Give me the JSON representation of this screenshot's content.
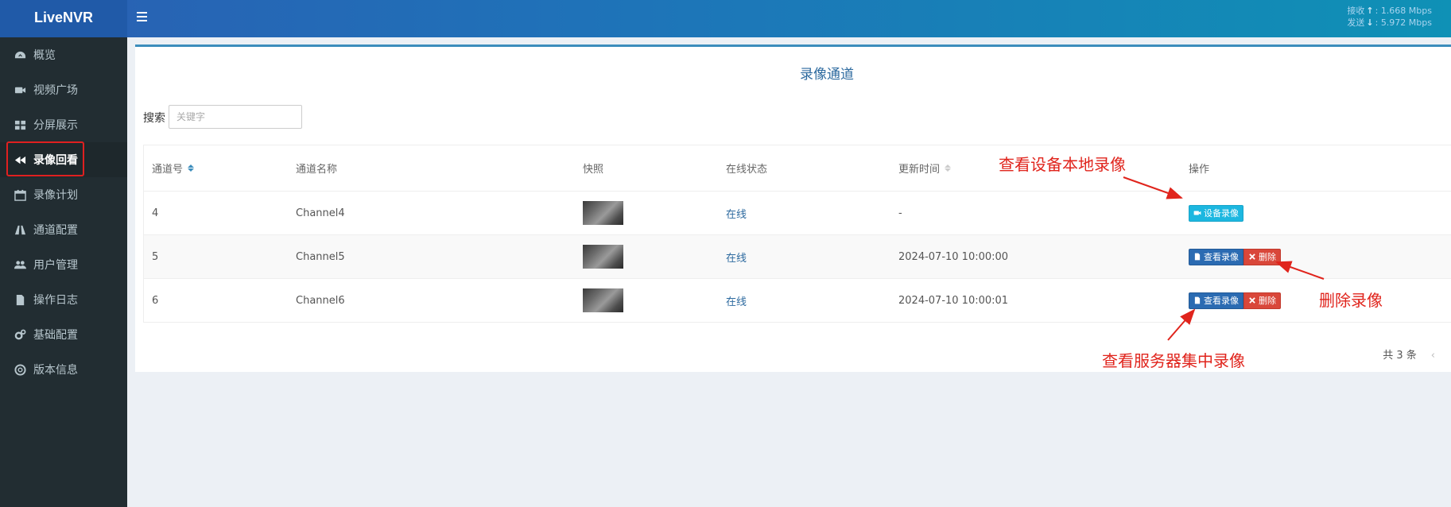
{
  "app": {
    "logo": "LiveNVR",
    "speed": {
      "recv_label": "接收",
      "recv_value": "1.668 Mbps",
      "send_label": "发送",
      "send_value": "5.972 Mbps"
    }
  },
  "sidebar": {
    "items": [
      {
        "label": "概览",
        "icon": "dashboard-icon"
      },
      {
        "label": "视频广场",
        "icon": "video-camera-icon"
      },
      {
        "label": "分屏展示",
        "icon": "grid-icon"
      },
      {
        "label": "录像回看",
        "icon": "rewind-icon",
        "active": true
      },
      {
        "label": "录像计划",
        "icon": "calendar-icon"
      },
      {
        "label": "通道配置",
        "icon": "road-icon"
      },
      {
        "label": "用户管理",
        "icon": "users-icon"
      },
      {
        "label": "操作日志",
        "icon": "file-icon"
      },
      {
        "label": "基础配置",
        "icon": "cogs-icon"
      },
      {
        "label": "版本信息",
        "icon": "life-ring-icon"
      }
    ]
  },
  "main": {
    "title": "录像通道",
    "search": {
      "label": "搜索",
      "placeholder": "关键字"
    },
    "table": {
      "columns": [
        "通道号",
        "通道名称",
        "快照",
        "在线状态",
        "更新时间",
        "操作"
      ],
      "rows": [
        {
          "id": "4",
          "name": "Channel4",
          "status": "在线",
          "updated": "-",
          "actions": [
            "设备录像"
          ]
        },
        {
          "id": "5",
          "name": "Channel5",
          "status": "在线",
          "updated": "2024-07-10 10:00:00",
          "actions": [
            "查看录像",
            "删除"
          ]
        },
        {
          "id": "6",
          "name": "Channel6",
          "status": "在线",
          "updated": "2024-07-10 10:00:01",
          "actions": [
            "查看录像",
            "删除"
          ]
        }
      ]
    },
    "pager": {
      "total": "共 3 条",
      "prev": "‹"
    }
  },
  "annotations": {
    "device_local": "查看设备本地录像",
    "delete": "删除录像",
    "server": "查看服务器集中录像"
  },
  "colors": {
    "accent": "#3c8dbc",
    "annotation": "#e0241c",
    "sidebar_bg": "#222d32"
  }
}
